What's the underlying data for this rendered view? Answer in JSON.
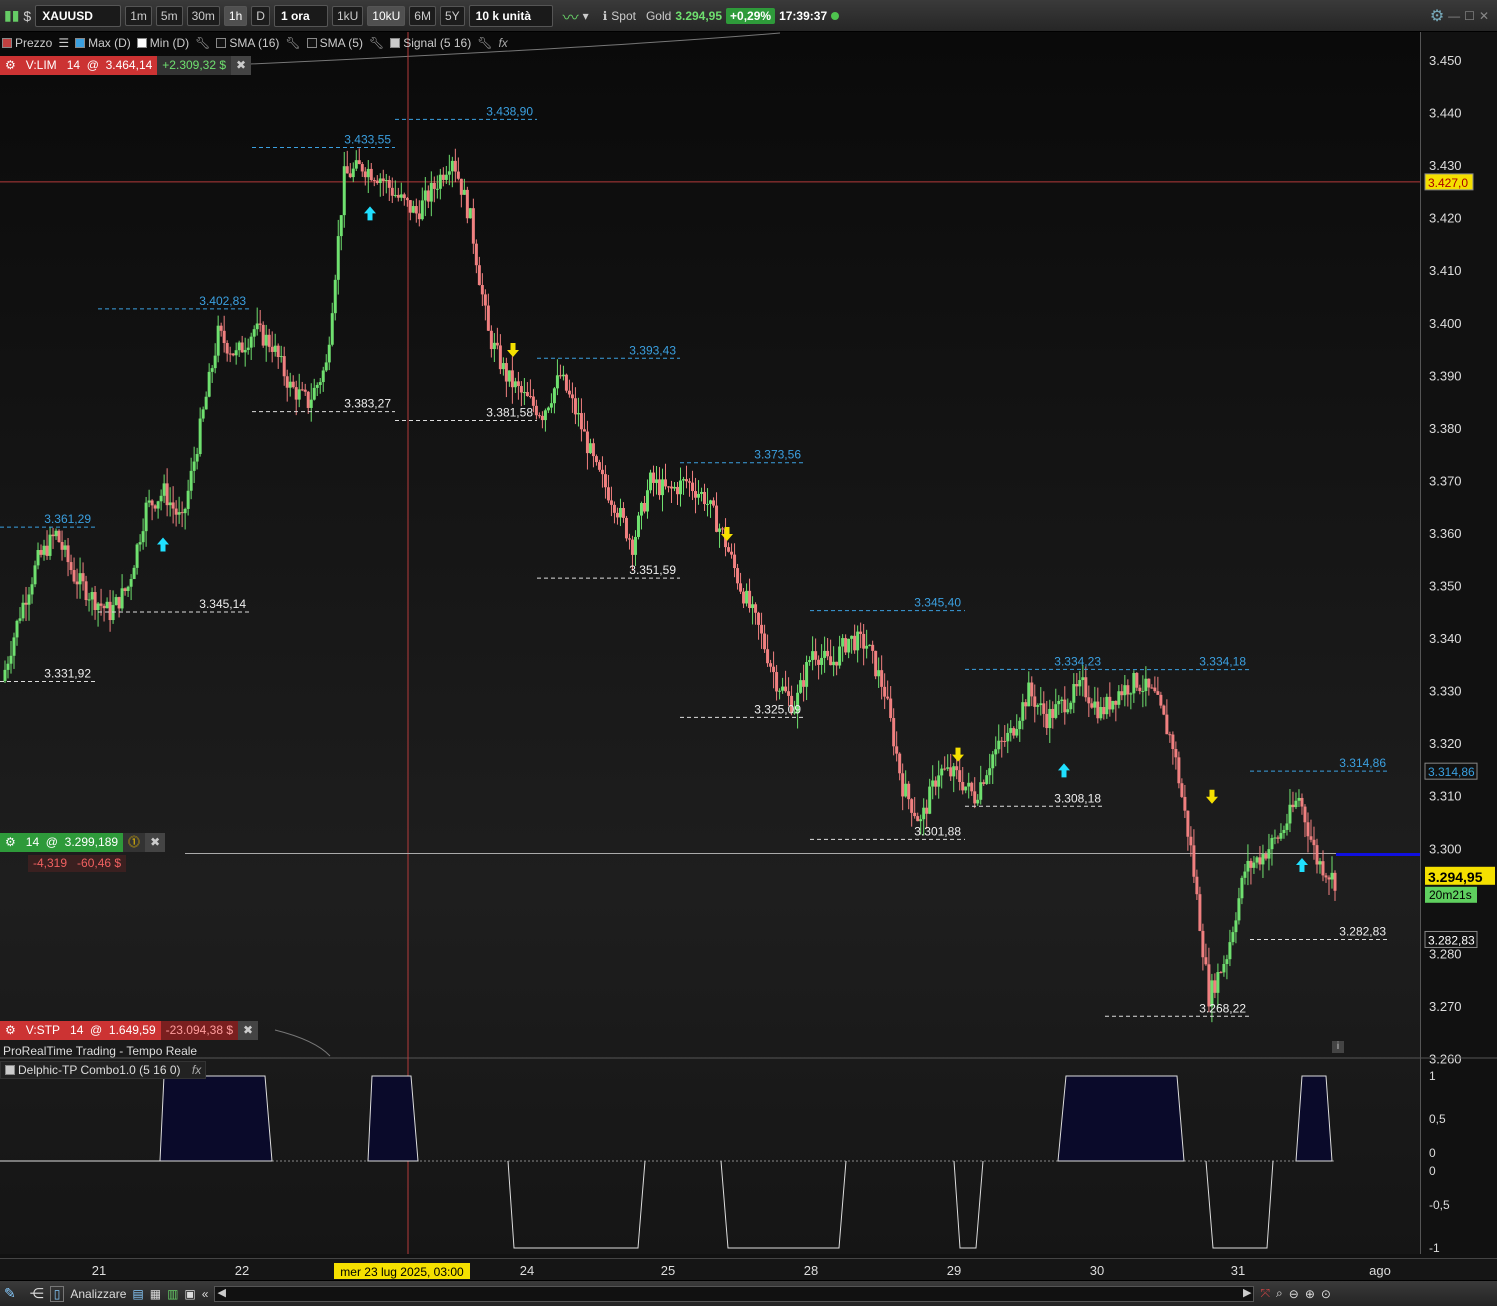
{
  "toolbar": {
    "symbol": "XAUUSD",
    "timeframes": [
      "1m",
      "5m",
      "30m",
      "1h",
      "D"
    ],
    "active_timeframe": "1h",
    "interval_select": "1 ora",
    "ranges": [
      "1kU",
      "10kU",
      "6M",
      "5Y"
    ],
    "active_range": "10kU",
    "units_select": "10 k unità",
    "spot_label": "Spot",
    "instrument_name": "Gold",
    "last_price": "3.294,95",
    "change_pct": "+0,29%",
    "clock": "17:39:37"
  },
  "legend": [
    {
      "label": "Prezzo",
      "color": "#c04040"
    },
    {
      "label": "Max (D)",
      "color": "#3ba0e0"
    },
    {
      "label": "Min (D)",
      "color": "#ffffff"
    },
    {
      "label": "SMA (16)",
      "color": "#111111"
    },
    {
      "label": "SMA (5)",
      "color": "#111111"
    },
    {
      "label": "Signal (5 16)",
      "color": "#cccccc"
    }
  ],
  "orders": {
    "limit": {
      "tag": "V:LIM",
      "qty": "14",
      "at": "@",
      "price": "3.464,14",
      "pnl": "+2.309,32 $"
    },
    "position": {
      "qty": "14",
      "at": "@",
      "price": "3.299,189",
      "points": "-4,319",
      "pnl": "-60,46 $"
    },
    "stop": {
      "tag": "V:STP",
      "qty": "14",
      "at": "@",
      "price": "1.649,59",
      "pnl": "-23.094,38 $"
    }
  },
  "footer_text": "ProRealTime Trading - Tempo Reale",
  "indicator_label": "Delphic-TP Combo1.0 (5 16 0)",
  "indicator_ticks": [
    "1",
    "0,5",
    "0",
    "0",
    "-0,5",
    "-1"
  ],
  "price_axis": {
    "ticks": [
      "3.450",
      "3.440",
      "3.430",
      "3.420",
      "3.410",
      "3.400",
      "3.390",
      "3.380",
      "3.370",
      "3.360",
      "3.350",
      "3.340",
      "3.330",
      "3.320",
      "3.310",
      "3.300",
      "3.280",
      "3.270",
      "3.260"
    ],
    "tag_red_line": "3.427,0",
    "tag_high": "3.314,86",
    "tag_last": "3.294,95",
    "tag_timer": "20m21s",
    "tag_low": "3.282,83"
  },
  "time_axis": {
    "labels": [
      "21",
      "22",
      "24",
      "25",
      "28",
      "29",
      "30",
      "31",
      "ago"
    ],
    "cursor_label": "mer 23 lug 2025, 03:00"
  },
  "highs": [
    "3.361,29",
    "3.402,83",
    "3.433,55",
    "3.438,90",
    "3.393,43",
    "3.373,56",
    "3.345,40",
    "3.334,23",
    "3.334,18",
    "3.314,86"
  ],
  "lows": [
    "3.331,92",
    "3.345,14",
    "3.383,27",
    "3.381,58",
    "3.351,59",
    "3.325,09",
    "3.301,88",
    "3.308,18",
    "3.268,22",
    "3.282,83"
  ],
  "bottom": {
    "analyze_label": "Analizzare"
  },
  "colors": {
    "up": "#6fe06f",
    "down": "#f08080",
    "high_line": "#3ba0e0",
    "cursor": "#b33b3b",
    "signal_fill": "#0a0a2a"
  },
  "chart_data": {
    "type": "candlestick",
    "instrument": "XAUUSD",
    "ylim": [
      3260,
      3450
    ],
    "last_price": 3294.95,
    "daily_highs": [
      3361.29,
      3402.83,
      3433.55,
      3438.9,
      3393.43,
      3373.56,
      3345.4,
      3334.23,
      3334.18,
      3314.86
    ],
    "daily_lows": [
      3331.92,
      3345.14,
      3383.27,
      3381.58,
      3351.59,
      3325.09,
      3301.88,
      3308.18,
      3268.22,
      3282.83
    ],
    "close_path": [
      3332,
      3345,
      3355,
      3360,
      3352,
      3348,
      3345,
      3350,
      3365,
      3368,
      3362,
      3380,
      3398,
      3394,
      3399,
      3396,
      3388,
      3385,
      3392,
      3428,
      3430,
      3428,
      3424,
      3421,
      3426,
      3432,
      3420,
      3398,
      3390,
      3386,
      3383,
      3390,
      3382,
      3372,
      3366,
      3358,
      3370,
      3368,
      3370,
      3367,
      3360,
      3350,
      3342,
      3332,
      3327,
      3338,
      3335,
      3340,
      3339,
      3330,
      3312,
      3305,
      3315,
      3314,
      3310,
      3318,
      3322,
      3330,
      3325,
      3328,
      3331,
      3326,
      3330,
      3332,
      3329,
      3320,
      3300,
      3272,
      3280,
      3296,
      3299,
      3303,
      3310,
      3298,
      3294
    ]
  }
}
